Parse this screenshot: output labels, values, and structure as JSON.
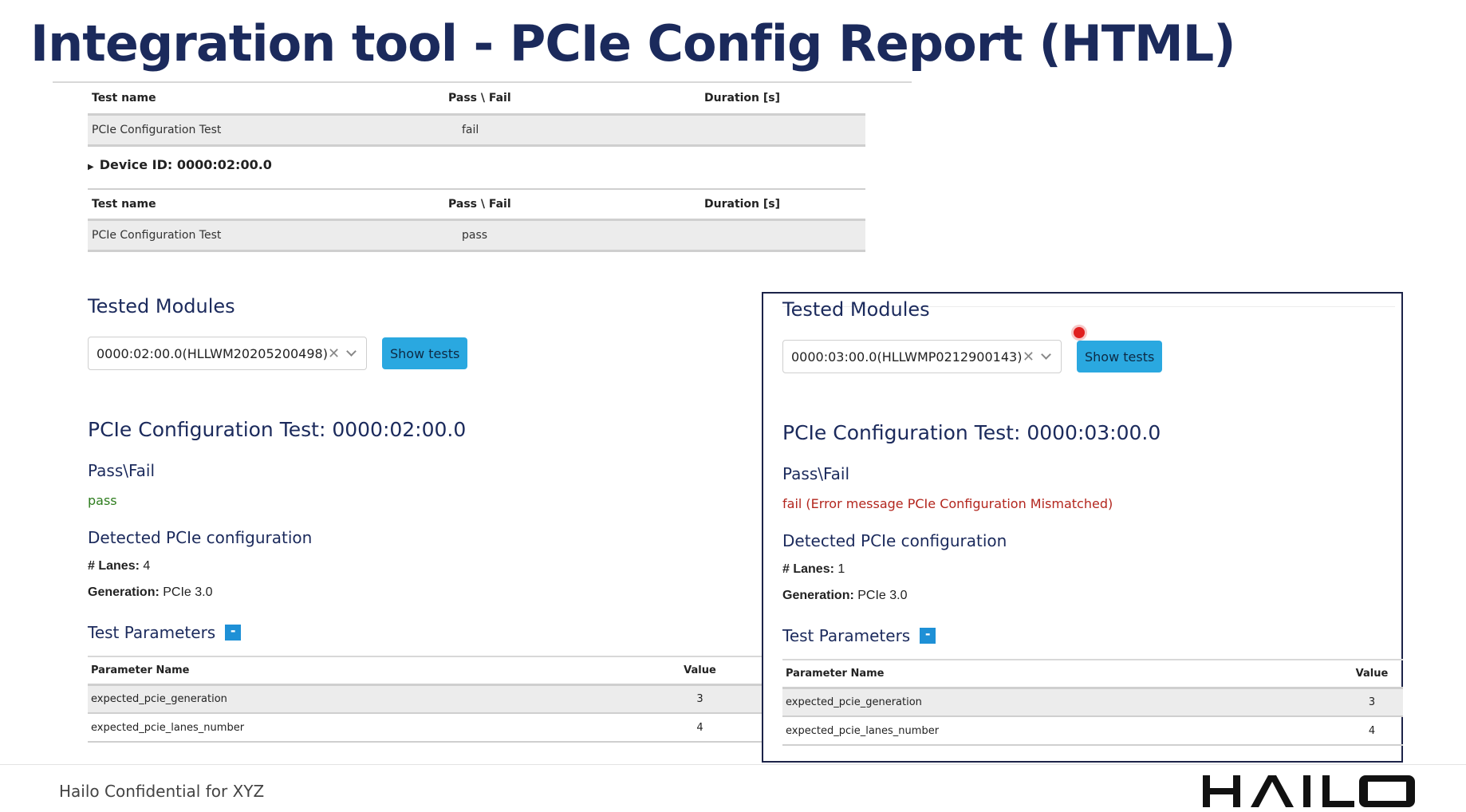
{
  "slide": {
    "title": "Integration tool - PCIe Config Report (HTML)",
    "footer": "Hailo Confidential for XYZ",
    "logo_text": "HAILO"
  },
  "summary": {
    "headers": {
      "name": "Test name",
      "pass_fail": "Pass \\ Fail",
      "duration": "Duration [s]"
    },
    "block1": {
      "test": "PCIe Configuration Test",
      "result": "fail",
      "duration": ""
    },
    "device_label": "Device ID: 0000:02:00.0",
    "block2": {
      "test": "PCIe Configuration Test",
      "result": "pass",
      "duration": ""
    }
  },
  "left_panel": {
    "heading": "Tested Modules",
    "selected_module": "0000:02:00.0(HLLWM20205200498)",
    "show_tests_label": "Show tests",
    "test_title": "PCIe Configuration Test: 0000:02:00.0",
    "pass_fail_heading": "Pass\\Fail",
    "result": "pass",
    "detected_heading": "Detected PCIe configuration",
    "lanes_label": "# Lanes:",
    "lanes_value": "4",
    "generation_label": "Generation:",
    "generation_value": "PCIe 3.0",
    "params_heading": "Test Parameters",
    "collapse_symbol": "-",
    "params_header": {
      "name": "Parameter Name",
      "value": "Value"
    },
    "params": [
      {
        "name": "expected_pcie_generation",
        "value": "3"
      },
      {
        "name": "expected_pcie_lanes_number",
        "value": "4"
      }
    ]
  },
  "right_panel": {
    "heading": "Tested Modules",
    "selected_module": "0000:03:00.0(HLLWMP0212900143)",
    "show_tests_label": "Show tests",
    "test_title": "PCIe Configuration Test: 0000:03:00.0",
    "pass_fail_heading": "Pass\\Fail",
    "result": "fail (Error message PCIe Configuration Mismatched)",
    "detected_heading": "Detected PCIe configuration",
    "lanes_label": "# Lanes:",
    "lanes_value": "1",
    "generation_label": "Generation:",
    "generation_value": "PCIe 3.0",
    "params_heading": "Test Parameters",
    "collapse_symbol": "-",
    "params_header": {
      "name": "Parameter Name",
      "value": "Value"
    },
    "params": [
      {
        "name": "expected_pcie_generation",
        "value": "3"
      },
      {
        "name": "expected_pcie_lanes_number",
        "value": "4"
      }
    ]
  },
  "colors": {
    "title_navy": "#1b2a5c",
    "pass_green": "#2e7d1e",
    "fail_red": "#b3261e",
    "button_blue": "#2aa8e0",
    "panel_border": "#1c2348"
  }
}
